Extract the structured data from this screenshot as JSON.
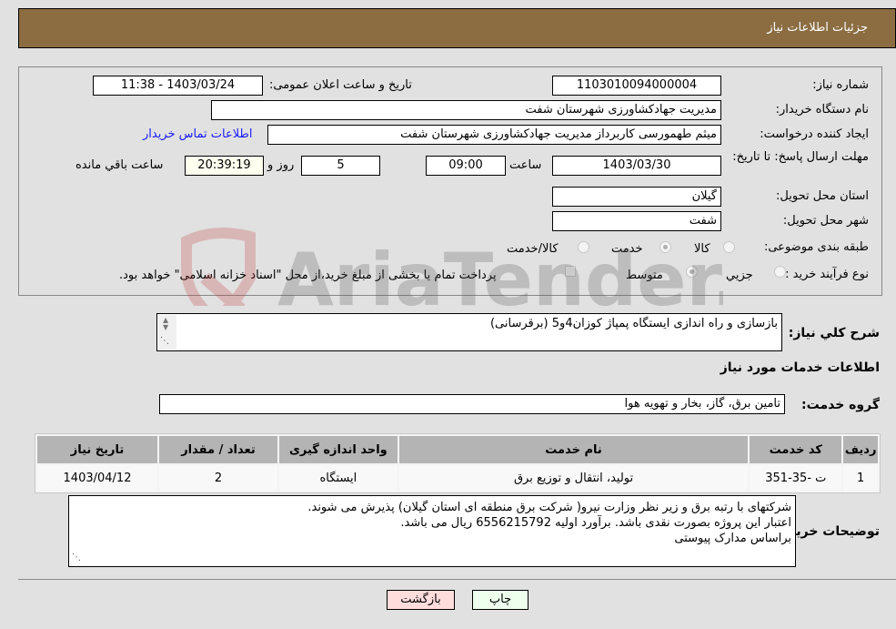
{
  "header": {
    "title": "جزئیات اطلاعات نیاز"
  },
  "details": {
    "need_number": {
      "label": "شماره نیاز:",
      "value": "1103010094000004"
    },
    "announce_datetime": {
      "label": "تاریخ و ساعت اعلان عمومی:",
      "value": "1403/03/24 - 11:38"
    },
    "buyer_org": {
      "label": "نام دستگاه خریدار:",
      "value": "مدیریت جهادکشاورزی شهرستان شفت"
    },
    "requester": {
      "label": "ایجاد کننده درخواست:",
      "value": "میثم طهمورسی کاربرداز مدیریت جهادکشاورزی شهرستان شفت"
    },
    "buyer_contact_link": "اطلاعات تماس خریدار",
    "deadline": {
      "label": "مهلت ارسال پاسخ: تا تاریخ:",
      "date": "1403/03/30",
      "time_label": "ساعت",
      "time": "09:00",
      "days": "5",
      "days_label": "روز و",
      "remaining": "20:39:19",
      "remaining_label": "ساعت باقي مانده"
    },
    "province": {
      "label": "استان محل تحویل:",
      "value": "گیلان"
    },
    "city": {
      "label": "شهر محل تحویل:",
      "value": "شفت"
    },
    "category": {
      "label": "طبقه بندی موضوعی:",
      "options": [
        "کالا",
        "خدمت",
        "کالا/خدمت"
      ],
      "selected": "خدمت"
    },
    "purchase_type": {
      "label": "نوع فرآیند خرید :",
      "options": [
        "جزيي",
        "متوسط"
      ],
      "selected": "متوسط",
      "treasury_note": "پرداخت تمام یا بخشی از مبلغ خرید،از محل \"اسناد خزانه اسلامی\" خواهد بود."
    }
  },
  "description": {
    "label": "شرح کلي نیاز:",
    "value": "بازسازی و راه اندازی ایستگاه پمپاژ کوزان4و5 (برقرسانی)"
  },
  "services": {
    "section_title": "اطلاعات خدمات مورد نیاز",
    "group_label": "گروه خدمت:",
    "group_value": "تامین برق، گاز، بخار و تهویه هوا",
    "table": {
      "headers": [
        "ردیف",
        "کد خدمت",
        "نام خدمت",
        "واحد اندازه گیری",
        "تعداد / مقدار",
        "تاریخ نیاز"
      ],
      "rows": [
        [
          "1",
          "ت -35-351",
          "تولید، انتقال و توزیع برق",
          "ایستگاه",
          "2",
          "1403/04/12"
        ]
      ]
    }
  },
  "buyer_notes": {
    "label": "توضیحات خریدار:",
    "lines": [
      "شرکتهای با رتبه برق و زیر نظر وزارت نیرو( شرکت برق منطقه ای استان گیلان) پذیرش می شوند.",
      " اعتبار این پروژه بصورت نقدی باشد. برآورد اولیه 6556215792 ریال می باشد.",
      "براساس مدارک پیوستی"
    ]
  },
  "buttons": {
    "print": "چاپ",
    "back": "بازگشت"
  },
  "watermark": "AriaTender.neT",
  "colors": {
    "header": "#8c6d42",
    "print_bg": "#eeffee",
    "back_bg": "#ffdddd",
    "link": "#1a1aff"
  }
}
